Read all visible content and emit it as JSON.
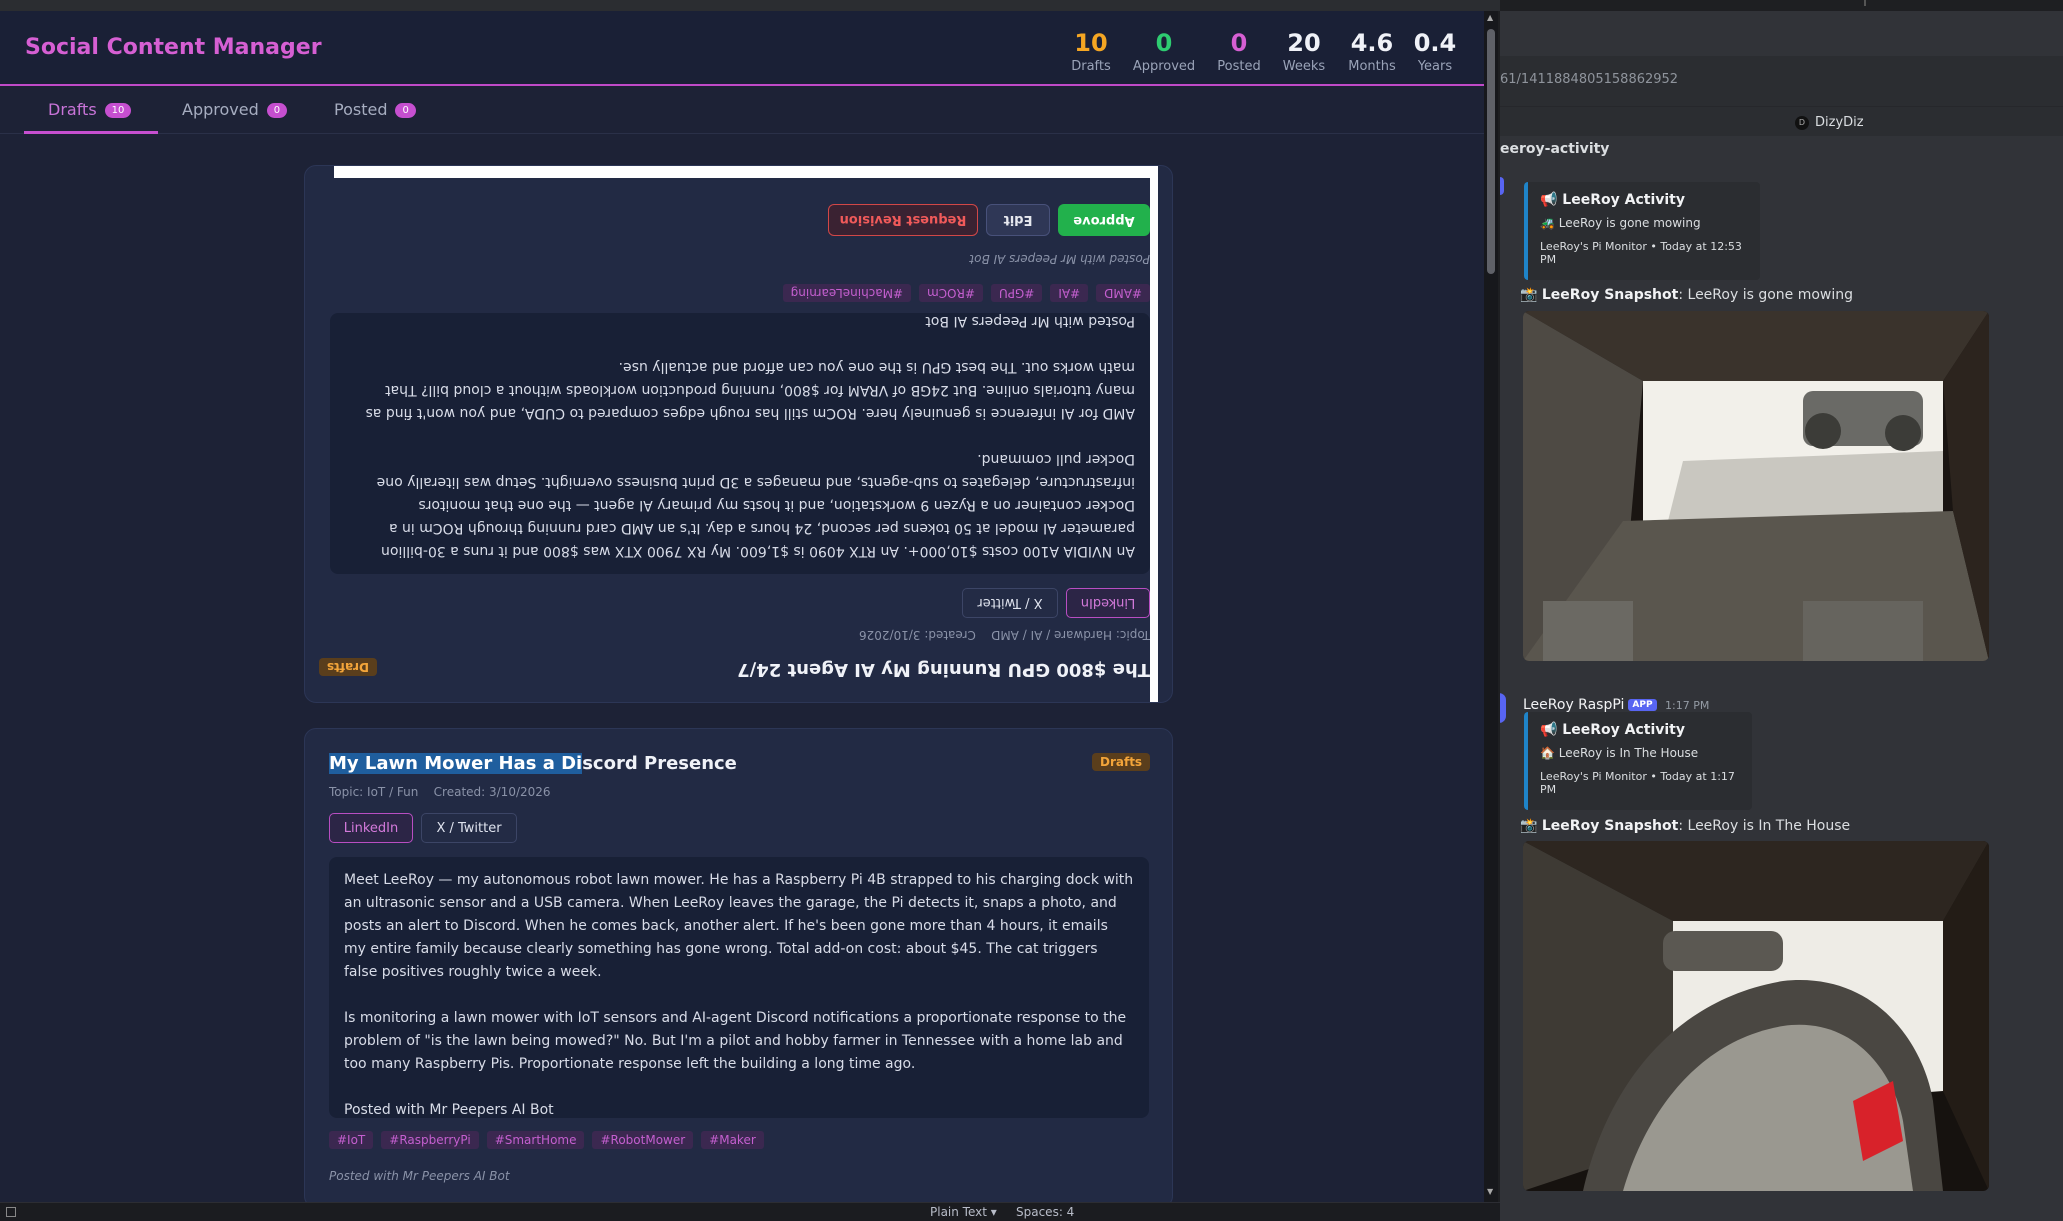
{
  "app": {
    "title": "Social Content Manager",
    "accent": "#c64fd0"
  },
  "stats": [
    {
      "value": "10",
      "label": "Drafts",
      "color": "#f5a623"
    },
    {
      "value": "0",
      "label": "Approved",
      "color": "#2ecc71"
    },
    {
      "value": "0",
      "label": "Posted",
      "color": "#d65fd3"
    },
    {
      "value": "20",
      "label": "Weeks",
      "color": "#f0f2f8"
    },
    {
      "value": "4.6",
      "label": "Months",
      "color": "#f0f2f8"
    },
    {
      "value": "0.4",
      "label": "Years",
      "color": "#f0f2f8"
    }
  ],
  "tabs": [
    {
      "label": "Drafts",
      "count": "10",
      "active": true
    },
    {
      "label": "Approved",
      "count": "0",
      "active": false
    },
    {
      "label": "Posted",
      "count": "0",
      "active": false
    }
  ],
  "cards": [
    {
      "title": "The $800 GPU Running My AI Agent 24/7",
      "topic": "Topic: Hardware / AI / AMD",
      "created": "Created: 3/10/2026",
      "status": "Drafts",
      "platforms": [
        "LinkedIn",
        "X / Twitter"
      ],
      "paragraphs": [
        "An NVIDIA A100 costs $10,000+. An RTX 4090 is $1,600. My RX 7900 XTX was $800 and it runs a 30-billion parameter AI model at 50 tokens per second, 24 hours a day. It's an AMD card running through ROCm in a Docker container on a Ryzen 9 workstation, and it hosts my primary AI agent — the one that monitors infrastructure, delegates to sub-agents, and manages a 3D print business overnight. Setup was literally one Docker pull command.",
        "AMD for AI inference is genuinely here. ROCm still has rough edges compared to CUDA, and you won't find as many tutorials online. But 24GB of VRAM for $800, running production workloads without a cloud bill? That math works out. The best GPU is the one you can afford and actually use.",
        "Posted with Mr Peepers AI Bot"
      ],
      "tags": [
        "#AMD",
        "#AI",
        "#GPU",
        "#ROCm",
        "#MachineLearning"
      ],
      "posted_note": "Posted with Mr Peepers AI Bot",
      "actions": [
        "Approve",
        "Edit",
        "Request Revision"
      ]
    },
    {
      "title_highlight": "My Lawn Mower Has a Di",
      "title_rest": "scord Presence",
      "topic": "Topic: IoT / Fun",
      "created": "Created: 3/10/2026",
      "status": "Drafts",
      "platforms": [
        "LinkedIn",
        "X / Twitter"
      ],
      "paragraphs": [
        "Meet LeeRoy — my autonomous robot lawn mower. He has a Raspberry Pi 4B strapped to his charging dock with an ultrasonic sensor and a USB camera. When LeeRoy leaves the garage, the Pi detects it, snaps a photo, and posts an alert to Discord. When he comes back, another alert. If he's been gone more than 4 hours, it emails my entire family because clearly something has gone wrong. Total add-on cost: about $45. The cat triggers false positives roughly twice a week.",
        "Is monitoring a lawn mower with IoT sensors and AI-agent Discord notifications a proportionate response to the problem of \"is the lawn being mowed?\" No. But I'm a pilot and hobby farmer in Tennessee with a home lab and too many Raspberry Pis. Proportionate response left the building a long time ago.",
        "Posted with Mr Peepers AI Bot"
      ],
      "tags": [
        "#IoT",
        "#RaspberryPi",
        "#SmartHome",
        "#RobotMower",
        "#Maker"
      ],
      "posted_note": "Posted with Mr Peepers AI Bot"
    }
  ],
  "statusbar": {
    "language": "Plain Text",
    "spaces": "Spaces: 4"
  },
  "discord": {
    "url": "61/1411884805158862952",
    "user_initial": "D",
    "user": "DizyDiz",
    "channel": "eeroy-activity",
    "embed1": {
      "title": "📢 LeeRoy Activity",
      "desc": "🚜 LeeRoy is gone mowing",
      "footer": "LeeRoy's Pi Monitor • Today at 12:53 PM"
    },
    "snap1_label": "LeeRoy Snapshot",
    "snap1_text": ": LeeRoy is gone mowing",
    "bot_name": "LeeRoy RaspPi",
    "app_badge": "APP",
    "bot_time": "1:17 PM",
    "embed2": {
      "title": "📢 LeeRoy Activity",
      "desc": "🏠 LeeRoy is In The House",
      "footer": "LeeRoy's Pi Monitor • Today at 1:17 PM"
    },
    "snap2_label": "LeeRoy Snapshot",
    "snap2_text": ": LeeRoy is In The House"
  }
}
